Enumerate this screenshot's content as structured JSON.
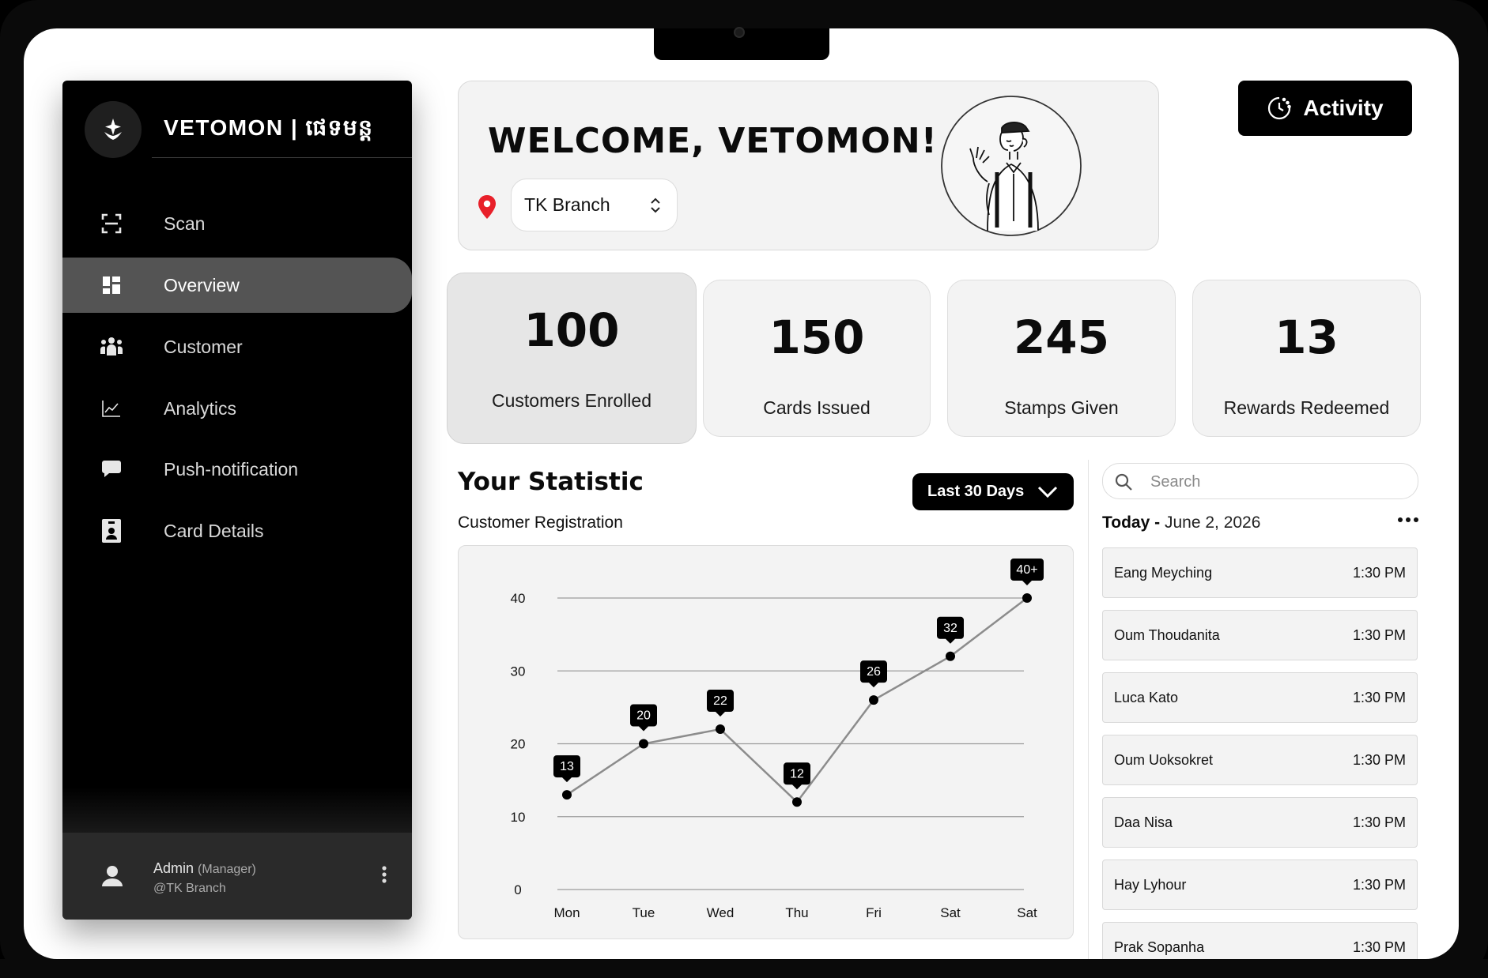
{
  "brand": {
    "name": "VETOMON | ផេទមន្ត"
  },
  "sidebar": {
    "items": [
      {
        "label": "Scan",
        "icon": "scan-icon"
      },
      {
        "label": "Overview",
        "icon": "dashboard-icon",
        "active": true
      },
      {
        "label": "Customer",
        "icon": "users-icon"
      },
      {
        "label": "Analytics",
        "icon": "analytics-icon"
      },
      {
        "label": "Push-notification",
        "icon": "chat-icon"
      },
      {
        "label": "Card Details",
        "icon": "id-card-icon"
      }
    ],
    "user": {
      "name": "Admin",
      "role": "(Manager)",
      "branch": "@TK Branch"
    }
  },
  "welcome": {
    "title": "WELCOME, VETOMON!",
    "branch": "TK Branch"
  },
  "activity_button": "Activity",
  "stats": [
    {
      "value": "100",
      "label": "Customers Enrolled"
    },
    {
      "value": "150",
      "label": "Cards Issued"
    },
    {
      "value": "245",
      "label": "Stamps Given"
    },
    {
      "value": "13",
      "label": "Rewards Redeemed"
    }
  ],
  "statistic": {
    "title": "Your Statistic",
    "subtitle": "Customer Registration",
    "range": "Last 30 Days"
  },
  "chart_data": {
    "type": "line",
    "title": "Customer Registration",
    "categories": [
      "Mon",
      "Tue",
      "Wed",
      "Thu",
      "Fri",
      "Sat",
      "Sat"
    ],
    "values": [
      13,
      20,
      22,
      12,
      26,
      32,
      40
    ],
    "data_labels": [
      "13",
      "20",
      "22",
      "12",
      "26",
      "32",
      "40+"
    ],
    "y_ticks": [
      "40",
      "30",
      "20",
      "10",
      "0"
    ],
    "ylim": [
      0,
      40
    ],
    "grid": true,
    "colors": {
      "line": "#8c8c8c",
      "point": "#000000",
      "label_bg": "#000000"
    }
  },
  "activity": {
    "search_placeholder": "Search",
    "today_label": "Today -",
    "date": "June 2, 2026",
    "entries": [
      {
        "name": "Eang Meyching",
        "time": "1:30 PM"
      },
      {
        "name": "Oum Thoudanita",
        "time": "1:30 PM"
      },
      {
        "name": "Luca Kato",
        "time": "1:30 PM"
      },
      {
        "name": "Oum Uoksokret",
        "time": "1:30 PM"
      },
      {
        "name": "Daa Nisa",
        "time": "1:30 PM"
      },
      {
        "name": "Hay Lyhour",
        "time": "1:30 PM"
      },
      {
        "name": "Prak Sopanha",
        "time": "1:30 PM"
      }
    ]
  },
  "colors": {
    "accent": "#000000",
    "pin": "#e8202a",
    "active_nav": "#545454"
  }
}
